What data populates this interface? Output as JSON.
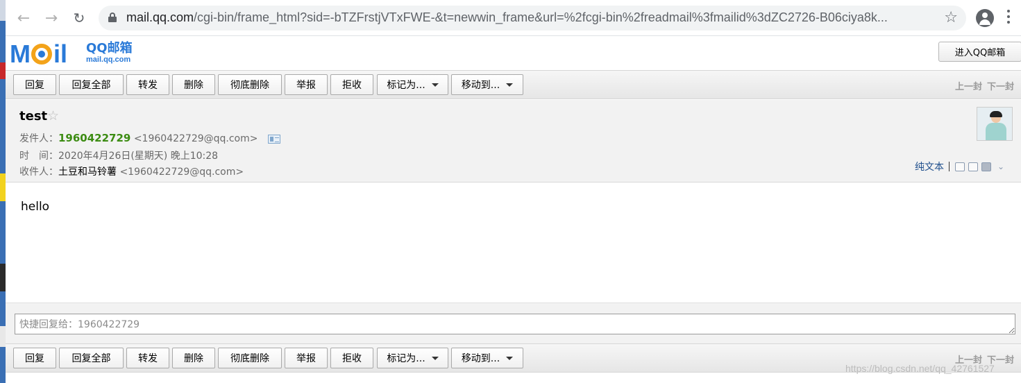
{
  "browser": {
    "url_host": "mail.qq.com",
    "url_rest": "/cgi-bin/frame_html?sid=-bTZFrstjVTxFWE-&t=newwin_frame&url=%2fcgi-bin%2freadmail%3fmailid%3dZC2726-B06ciya8k..."
  },
  "header": {
    "logo_text_cn": "QQ邮箱",
    "logo_text_en": "mail.qq.com",
    "enter_button": "进入QQ邮箱"
  },
  "toolbar": {
    "reply": "回复",
    "reply_all": "回复全部",
    "forward": "转发",
    "delete": "删除",
    "delete_permanent": "彻底删除",
    "report": "举报",
    "reject": "拒收",
    "mark_as": "标记为...",
    "move_to": "移动到...",
    "prev": "上一封",
    "next": "下一封"
  },
  "mail": {
    "subject": "test",
    "from_label": "发件人：",
    "from_name": "1960422729",
    "from_addr": "<1960422729@qq.com>",
    "time_label": "时　间：",
    "time_value": "2020年4月26日(星期天) 晚上10:28",
    "to_label": "收件人：",
    "to_name": "土豆和马铃薯",
    "to_addr": "<1960422729@qq.com>",
    "plain_text_link": "纯文本",
    "body": "hello"
  },
  "quick_reply": {
    "placeholder": "快捷回复给：1960422729"
  },
  "watermark": "https://blog.csdn.net/qq_42761527",
  "colors": {
    "sender_green": "#3c8c12",
    "logo_blue": "#2a7ad8",
    "logo_orange": "#f3a31a",
    "link_blue": "#1e4e8c"
  }
}
